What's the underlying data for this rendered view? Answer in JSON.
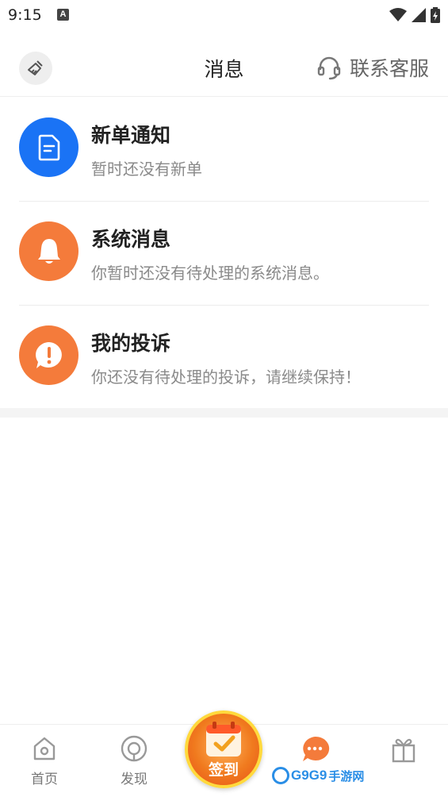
{
  "status_bar": {
    "time": "9:15",
    "notification_letter": "A",
    "icons": [
      "wifi-icon",
      "cellular-signal-icon",
      "battery-charging-icon"
    ]
  },
  "header": {
    "title": "消息",
    "clean_icon": "broom-icon",
    "service_label": "联系客服",
    "service_icon": "headset-icon"
  },
  "messages": [
    {
      "title": "新单通知",
      "desc": "暂时还没有新单",
      "icon": "document-icon",
      "color": "#1a73f5"
    },
    {
      "title": "系统消息",
      "desc": "你暂时还没有待处理的系统消息。",
      "icon": "bell-icon",
      "color": "#f47b3b"
    },
    {
      "title": "我的投诉",
      "desc": "你还没有待处理的投诉，请继续保持！",
      "icon": "exclamation-bubble-icon",
      "color": "#f47b3b"
    }
  ],
  "bottom_nav": {
    "items": [
      {
        "label": "首页",
        "icon": "home-icon"
      },
      {
        "label": "发现",
        "icon": "discover-icon"
      },
      {
        "label": "签到",
        "icon": "calendar-check-icon"
      },
      {
        "label": "",
        "icon": "chat-bubble-icon",
        "active_color": "#f47b3b"
      },
      {
        "label": "",
        "icon": "gift-icon"
      }
    ]
  },
  "watermark": {
    "brand": "G9G9",
    "suffix": "手游网"
  },
  "colors": {
    "accent": "#f47b3b",
    "blue": "#1a73f5",
    "title_text": "#222222",
    "secondary_text": "#8a8a8a"
  }
}
